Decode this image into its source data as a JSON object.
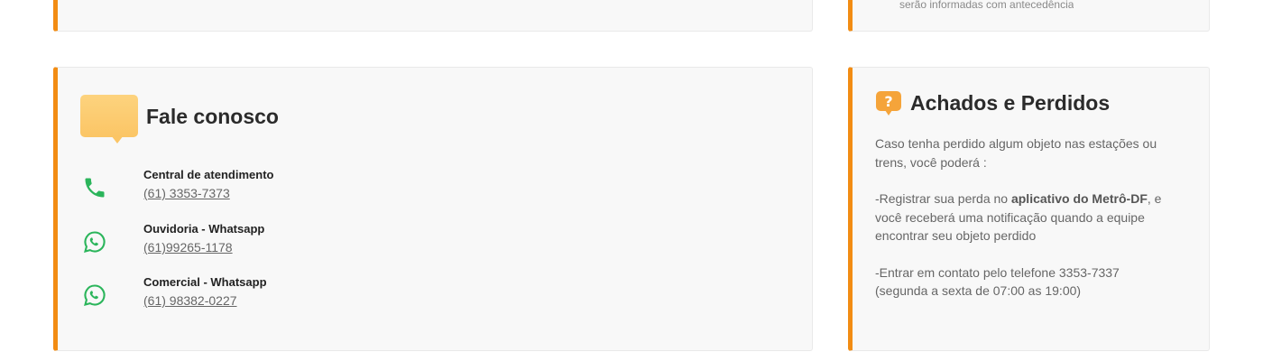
{
  "top_right_snippet": "serão informadas com antecedência",
  "contact": {
    "title": "Fale conosco",
    "items": [
      {
        "label": "Central de atendimento",
        "value": "(61) 3353-7373",
        "icon": "phone-icon"
      },
      {
        "label": "Ouvidoria - Whatsapp",
        "value": "(61)99265-1178",
        "icon": "whatsapp-icon"
      },
      {
        "label": "Comercial - Whatsapp",
        "value": "(61) 98382-0227",
        "icon": "whatsapp-icon"
      }
    ]
  },
  "lost_found": {
    "title": "Achados e Perdidos",
    "intro": "Caso tenha perdido algum objeto nas estações ou trens, você poderá :",
    "p2_prefix": "-Registrar sua perda no ",
    "p2_bold": "aplicativo do Metrô-DF",
    "p2_suffix": ", e você receberá uma notificação quando a equipe encontrar seu objeto perdido",
    "p3_line1": "-Entrar em contato pelo telefone 3353-7337",
    "p3_line2": "(segunda a sexta de 07:00 as 19:00)"
  },
  "colors": {
    "accent": "#f28c13",
    "icon_green": "#2bb55b",
    "bubble": "#fbc565",
    "question_icon": "#f5a43a"
  }
}
